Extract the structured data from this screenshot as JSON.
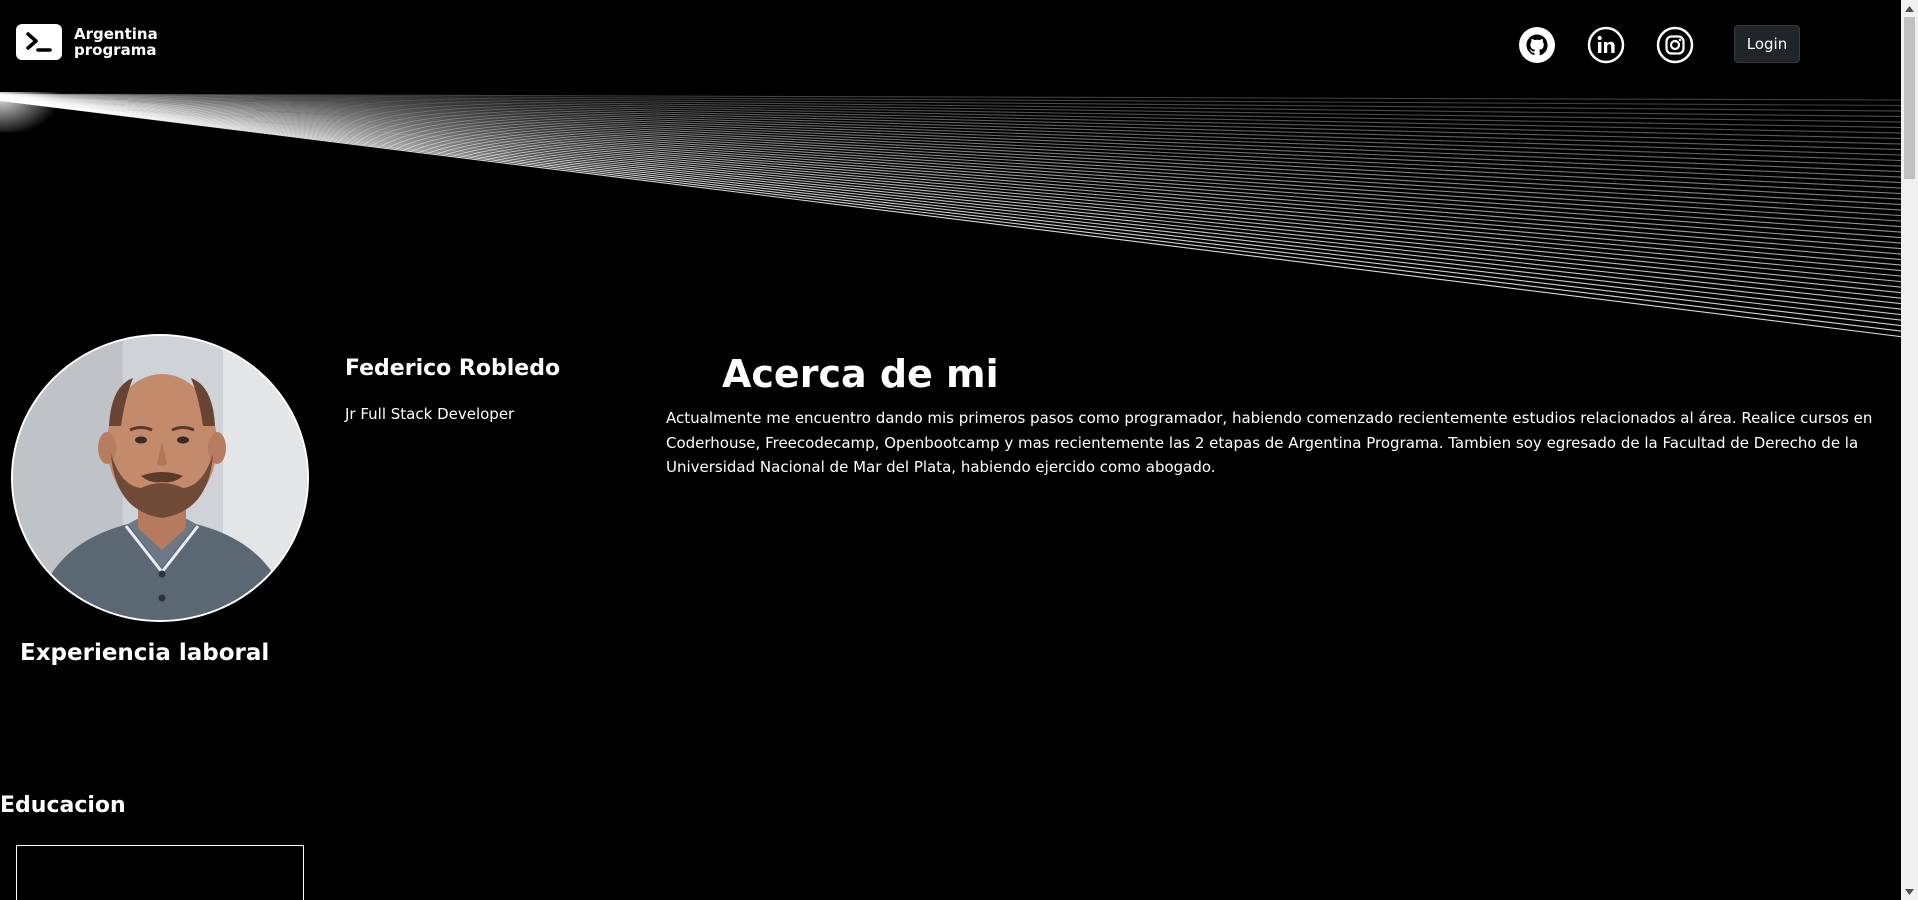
{
  "header": {
    "logo_line1": "Argentina",
    "logo_line2": "programa",
    "social_icons": [
      "github-icon",
      "linkedin-icon",
      "instagram-icon"
    ],
    "login_label": "Login"
  },
  "profile": {
    "name": "Federico Robledo",
    "role": "Jr Full Stack Developer"
  },
  "about": {
    "title": "Acerca de mi",
    "text": "Actualmente me encuentro dando mis primeros pasos como programador, habiendo comenzado recientemente estudios relacionados al área. Realice cursos en Coderhouse, Freecodecamp, Openbootcamp y mas recientemente las 2 etapas de Argentina Programa. Tambien soy egresado de la Facultad de Derecho de la Universidad Nacional de Mar del Plata, habiendo ejercido como abogado."
  },
  "sections": {
    "experience": "Experiencia laboral",
    "education": "Educacion"
  },
  "colors": {
    "background": "#000000",
    "text": "#ffffff",
    "button": "#212529"
  }
}
